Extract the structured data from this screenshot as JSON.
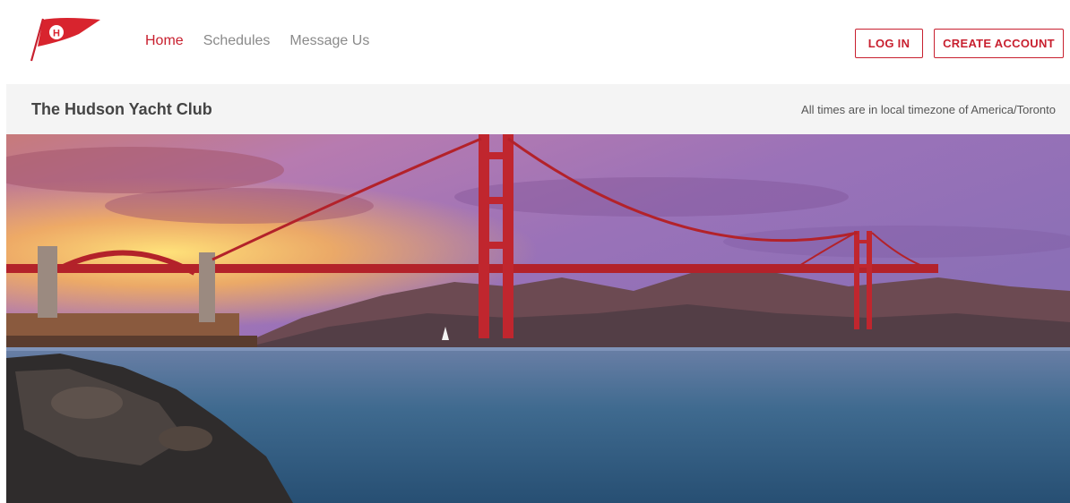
{
  "brand": {
    "logo_icon": "pennant-flag-icon",
    "logo_letter": "H",
    "accent_color": "#c8202f"
  },
  "nav": {
    "items": [
      {
        "label": "Home",
        "active": true
      },
      {
        "label": "Schedules",
        "active": false
      },
      {
        "label": "Message Us",
        "active": false
      }
    ]
  },
  "auth": {
    "login_label": "LOG IN",
    "create_account_label": "CREATE ACCOUNT"
  },
  "club": {
    "title": "The Hudson Yacht Club",
    "timezone_note": "All times are in local timezone of America/Toronto"
  },
  "hero": {
    "image_subject": "golden-gate-bridge-sunset"
  }
}
